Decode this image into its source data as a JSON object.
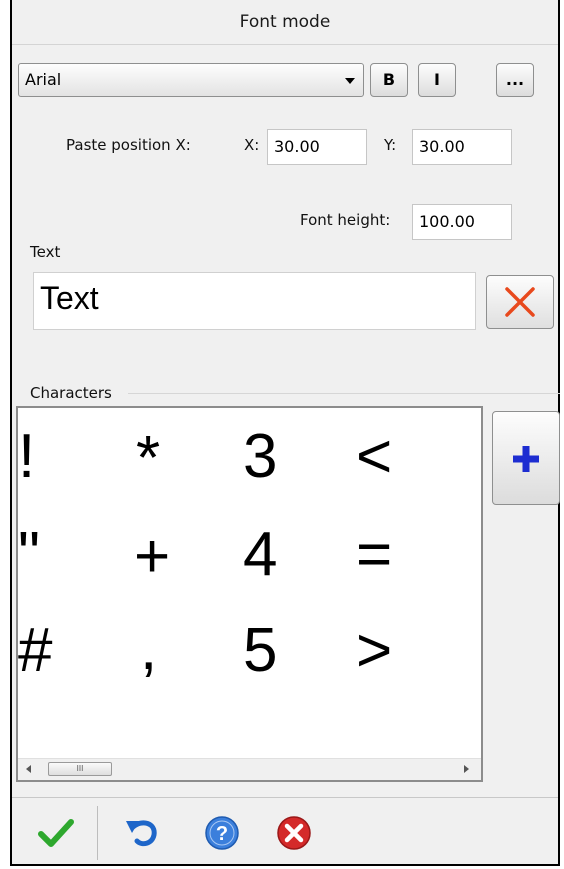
{
  "title": "Font mode",
  "font": {
    "selected": "Arial",
    "bold_label": "B",
    "italic_label": "I",
    "more_label": "..."
  },
  "paste_position": {
    "label": "Paste position X:",
    "x_label": "X:",
    "x_value": "30.00",
    "y_label": "Y:",
    "y_value": "30.00"
  },
  "font_height": {
    "label": "Font height:",
    "value": "100.00"
  },
  "text_section": {
    "label": "Text",
    "value": "Text"
  },
  "characters": {
    "label": "Characters",
    "glyphs": [
      "!",
      "\"",
      "#",
      "*",
      "+",
      ",",
      "3",
      "4",
      "5",
      "<",
      "=",
      ">"
    ],
    "scroll_thumb": "III"
  },
  "footer": {
    "icons": [
      "checkmark-icon",
      "undo-icon",
      "help-icon",
      "cancel-icon"
    ]
  },
  "colors": {
    "clear_x": "#e8491d",
    "add_plus": "#1d2dd1",
    "ok_green": "#2ea82e",
    "undo_blue": "#1e66c9",
    "help_blue": "#3b7fdc",
    "cancel_red": "#d42a2a"
  }
}
